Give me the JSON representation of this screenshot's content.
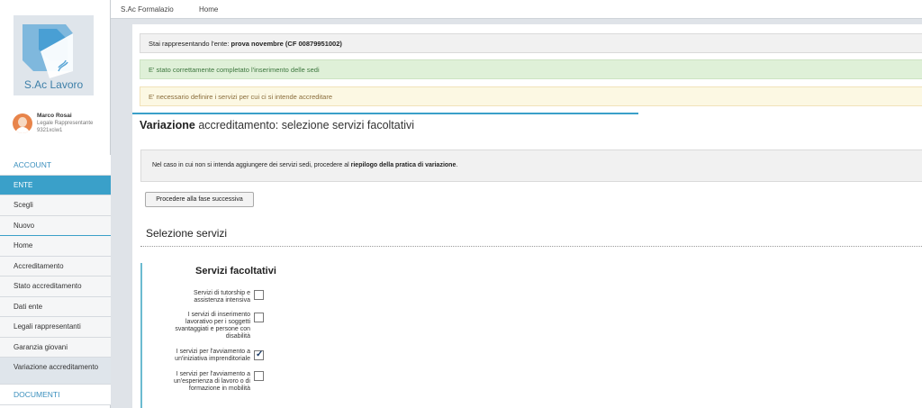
{
  "app": {
    "logo_text": "S.Ac Lavoro"
  },
  "topbar": {
    "links": [
      "S.Ac Formalazio",
      "Home"
    ]
  },
  "user": {
    "name": "Marco Rosai",
    "role": "Legale Rappresentante",
    "code": "9321xciw1"
  },
  "nav": {
    "items": [
      "ACCOUNT",
      "ENTE",
      "Scegli",
      "Nuovo",
      "Home",
      "Accreditamento",
      "Stato accreditamento",
      "Dati ente",
      "Legali rappresentanti",
      "Garanzia giovani",
      "Variazione accreditamento",
      "DOCUMENTI"
    ]
  },
  "alerts": {
    "info_prefix": "Stai rappresentando l'ente: ",
    "info_entity": "prova novembre (CF 00879951002)",
    "success": "E' stato correttamente completato l'inserimento delle sedi",
    "warning": "E' necessario definire i servizi per cui ci si intende accreditare"
  },
  "page": {
    "title_bold": "Variazione",
    "title_rest": " accreditamento: selezione servizi facoltativi"
  },
  "notice": {
    "prefix": "Nel caso in cui non si intenda aggiungere dei servizi sedi, procedere al ",
    "bold": "riepilogo della pratica di variazione",
    "suffix": "."
  },
  "next_button": "Procedere alla fase successiva",
  "section_title": "Selezione servizi",
  "fieldset_title": "Servizi facoltativi",
  "services": [
    {
      "label": "Servizi di tutorship e assistenza intensiva",
      "checked": false
    },
    {
      "label": "I servizi di inserimento lavorativo per i soggetti svantaggiati e persone con disabilità",
      "checked": false
    },
    {
      "label": "I servizi per l'avviamento a un'iniziativa imprenditoriale",
      "checked": true
    },
    {
      "label": "I servizi per l'avviamento a un'esperienza di lavoro o di formazione in mobilità",
      "checked": false
    }
  ]
}
